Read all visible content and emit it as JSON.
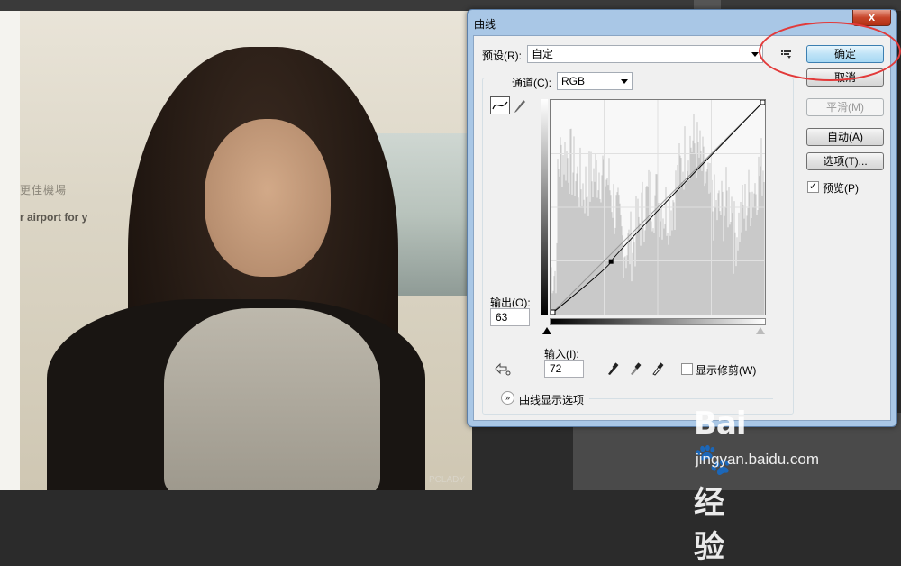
{
  "dialog": {
    "title": "曲线",
    "close_label": "x",
    "preset_label": "预设(R):",
    "preset_value": "自定",
    "channel_label": "通道(C):",
    "channel_value": "RGB",
    "output_label": "输出(O):",
    "output_value": "63",
    "input_label": "输入(I):",
    "input_value": "72",
    "show_clipping_label": "显示修剪(W)",
    "show_clipping_checked": false,
    "curve_display_options_label": "曲线显示选项",
    "buttons": {
      "ok": "确定",
      "cancel": "取消",
      "smooth": "平滑(M)",
      "auto": "自动(A)",
      "options": "选项(T)..."
    },
    "preview_label": "预览(P)",
    "preview_checked": true,
    "preview_check_glyph": "✓",
    "curve_point": {
      "input": 72,
      "output": 63
    },
    "histogram_color": "#c9c9c9",
    "curve_color": "#000000"
  },
  "canvas": {
    "wall_text_line1": "更佳機場",
    "wall_text_line2": "r airport for y",
    "photo_watermark": "PCLADY"
  },
  "watermark": {
    "logo_text": "Bai🐾经验",
    "url": "jingyan.baidu.com"
  },
  "colors": {
    "titlebar": "#a9c7e6",
    "close_button": "#c7452a",
    "highlight_ellipse": "#e23a3a"
  }
}
